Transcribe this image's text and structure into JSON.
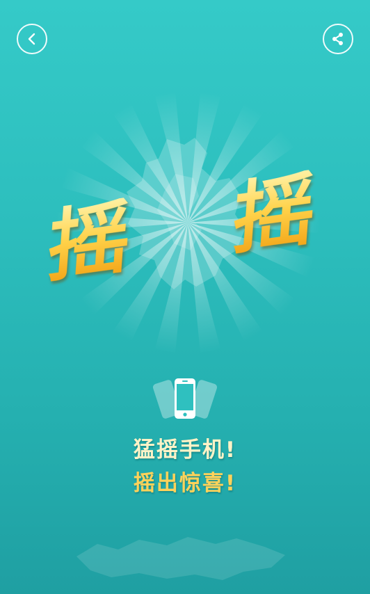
{
  "header": {
    "back_icon": "chevron-left-icon",
    "share_icon": "share-icon"
  },
  "hero": {
    "left_char": "摇",
    "right_char": "摇"
  },
  "shake_icon": "phone-shake-icon",
  "tagline": {
    "line1": "猛摇手机!",
    "line2": "摇出惊喜!"
  },
  "colors": {
    "background_top": "#35cac8",
    "background_bottom": "#1f9fa2",
    "gold": "#ffd24a",
    "cream": "#fff3c7"
  }
}
